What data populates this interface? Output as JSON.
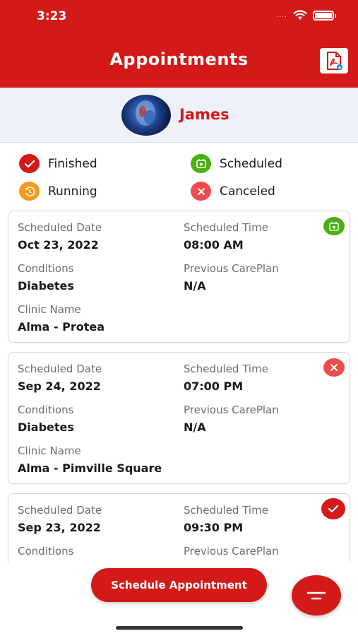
{
  "status_bar": {
    "time": "3:23",
    "signal": "....",
    "wifi_icon": "wifi-icon",
    "battery_icon": "battery-icon"
  },
  "header": {
    "title": "Appointments",
    "pdf_icon": "pdf-export-icon"
  },
  "patient": {
    "name": "James"
  },
  "legend": {
    "finished": "Finished",
    "scheduled": "Scheduled",
    "running": "Running",
    "canceled": "Canceled"
  },
  "colors": {
    "brand": "#d41919",
    "finished": "#d41919",
    "scheduled": "#4caf14",
    "running": "#f39a1c",
    "canceled": "#f04a4a"
  },
  "labels": {
    "scheduled_date": "Scheduled Date",
    "scheduled_time": "Scheduled Time",
    "conditions": "Conditions",
    "previous_careplan": "Previous CarePlan",
    "clinic_name": "Clinic Name"
  },
  "appointments": [
    {
      "status": "scheduled",
      "date": "Oct 23, 2022",
      "time": "08:00 AM",
      "conditions": "Diabetes",
      "previous_careplan": "N/A",
      "clinic": "Alma - Protea"
    },
    {
      "status": "canceled",
      "date": "Sep 24, 2022",
      "time": "07:00 PM",
      "conditions": "Diabetes",
      "previous_careplan": "N/A",
      "clinic": "Alma - Pimville Square"
    },
    {
      "status": "finished",
      "date": "Sep 23, 2022",
      "time": "09:30 PM",
      "conditions": "",
      "previous_careplan": "",
      "clinic": ""
    }
  ],
  "actions": {
    "schedule_button": "Schedule Appointment",
    "filter_icon": "filter-icon"
  }
}
